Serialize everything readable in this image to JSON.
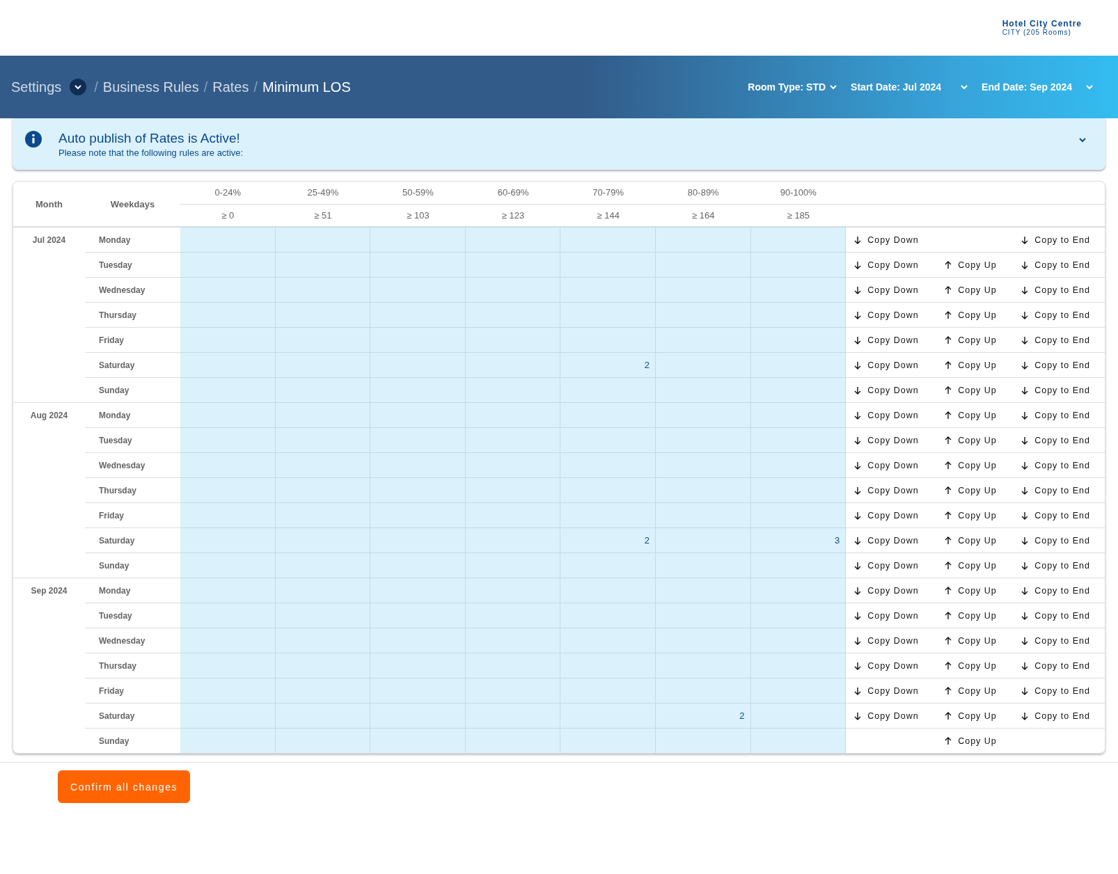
{
  "hotel": {
    "name": "Hotel City Centre",
    "subtitle": "CITY (205 Rooms)"
  },
  "breadcrumb": [
    {
      "label": "Settings",
      "dropdown": true,
      "current": false
    },
    {
      "separator": "/",
      "label": "Business Rules",
      "current": false
    },
    {
      "separator": "/",
      "label": "Rates",
      "current": false
    },
    {
      "separator": "/",
      "label": "Minimum LOS",
      "current": true
    }
  ],
  "filters": [
    {
      "label": "Room Type: STD"
    },
    {
      "label": "Start Date: Jul 2024"
    },
    {
      "label": "End Date: Sep 2024"
    }
  ],
  "alert": {
    "title": "Auto publish of Rates is Active!",
    "message": "Please note that the following rules are active:",
    "expanded": false
  },
  "table": {
    "columns": [
      "Month",
      "Weekdays"
    ],
    "bands": [
      {
        "occupancy": "0-24%",
        "threshold": "≥ 0"
      },
      {
        "occupancy": "25-49%",
        "threshold": "≥ 51"
      },
      {
        "occupancy": "50-59%",
        "threshold": "≥ 103"
      },
      {
        "occupancy": "60-69%",
        "threshold": "≥ 123"
      },
      {
        "occupancy": "70-79%",
        "threshold": "≥ 144"
      },
      {
        "occupancy": "80-89%",
        "threshold": "≥ 164"
      },
      {
        "occupancy": "90-100%",
        "threshold": "≥ 185"
      }
    ],
    "months": [
      {
        "month": "Jul 2024",
        "rows": [
          {
            "day": "Monday",
            "cells": [
              {},
              {},
              {},
              {},
              {},
              {},
              {}
            ],
            "actions": [
              {
                "kind": "down",
                "label": "Copy Down"
              },
              {
                "kind": "end",
                "label": "Copy to End"
              }
            ]
          },
          {
            "day": "Tuesday",
            "cells": [
              {},
              {},
              {},
              {},
              {},
              {},
              {}
            ],
            "actions": [
              {
                "kind": "down",
                "label": "Copy Down"
              },
              {
                "kind": "up",
                "label": "Copy Up"
              },
              {
                "kind": "end",
                "label": "Copy to End"
              }
            ]
          },
          {
            "day": "Wednesday",
            "cells": [
              {},
              {},
              {},
              {},
              {},
              {},
              {}
            ],
            "actions": [
              {
                "kind": "down",
                "label": "Copy Down"
              },
              {
                "kind": "up",
                "label": "Copy Up"
              },
              {
                "kind": "end",
                "label": "Copy to End"
              }
            ]
          },
          {
            "day": "Thursday",
            "cells": [
              {},
              {},
              {},
              {},
              {},
              {},
              {}
            ],
            "actions": [
              {
                "kind": "down",
                "label": "Copy Down"
              },
              {
                "kind": "up",
                "label": "Copy Up"
              },
              {
                "kind": "end",
                "label": "Copy to End"
              }
            ]
          },
          {
            "day": "Friday",
            "cells": [
              {},
              {},
              {},
              {},
              {},
              {},
              {}
            ],
            "actions": [
              {
                "kind": "down",
                "label": "Copy Down"
              },
              {
                "kind": "up",
                "label": "Copy Up"
              },
              {
                "kind": "end",
                "label": "Copy to End"
              }
            ]
          },
          {
            "day": "Saturday",
            "cells": [
              {},
              {},
              {},
              {},
              {
                "value": "2"
              },
              {},
              {}
            ],
            "actions": [
              {
                "kind": "down",
                "label": "Copy Down"
              },
              {
                "kind": "up",
                "label": "Copy Up"
              },
              {
                "kind": "end",
                "label": "Copy to End"
              }
            ]
          },
          {
            "day": "Sunday",
            "cells": [
              {},
              {},
              {},
              {},
              {},
              {},
              {}
            ],
            "actions": [
              {
                "kind": "down",
                "label": "Copy Down"
              },
              {
                "kind": "up",
                "label": "Copy Up"
              },
              {
                "kind": "end",
                "label": "Copy to End"
              }
            ]
          }
        ]
      },
      {
        "month": "Aug 2024",
        "rows": [
          {
            "day": "Monday",
            "cells": [
              {},
              {},
              {},
              {},
              {},
              {},
              {}
            ],
            "actions": [
              {
                "kind": "down",
                "label": "Copy Down"
              },
              {
                "kind": "up",
                "label": "Copy Up"
              },
              {
                "kind": "end",
                "label": "Copy to End"
              }
            ]
          },
          {
            "day": "Tuesday",
            "cells": [
              {},
              {},
              {},
              {},
              {},
              {},
              {}
            ],
            "actions": [
              {
                "kind": "down",
                "label": "Copy Down"
              },
              {
                "kind": "up",
                "label": "Copy Up"
              },
              {
                "kind": "end",
                "label": "Copy to End"
              }
            ]
          },
          {
            "day": "Wednesday",
            "cells": [
              {},
              {},
              {},
              {},
              {},
              {},
              {}
            ],
            "actions": [
              {
                "kind": "down",
                "label": "Copy Down"
              },
              {
                "kind": "up",
                "label": "Copy Up"
              },
              {
                "kind": "end",
                "label": "Copy to End"
              }
            ]
          },
          {
            "day": "Thursday",
            "cells": [
              {},
              {},
              {},
              {},
              {},
              {},
              {}
            ],
            "actions": [
              {
                "kind": "down",
                "label": "Copy Down"
              },
              {
                "kind": "up",
                "label": "Copy Up"
              },
              {
                "kind": "end",
                "label": "Copy to End"
              }
            ]
          },
          {
            "day": "Friday",
            "cells": [
              {},
              {},
              {},
              {},
              {},
              {},
              {}
            ],
            "actions": [
              {
                "kind": "down",
                "label": "Copy Down"
              },
              {
                "kind": "up",
                "label": "Copy Up"
              },
              {
                "kind": "end",
                "label": "Copy to End"
              }
            ]
          },
          {
            "day": "Saturday",
            "cells": [
              {},
              {},
              {},
              {},
              {
                "value": "2"
              },
              {},
              {
                "value": "3"
              }
            ],
            "actions": [
              {
                "kind": "down",
                "label": "Copy Down"
              },
              {
                "kind": "up",
                "label": "Copy Up"
              },
              {
                "kind": "end",
                "label": "Copy to End"
              }
            ]
          },
          {
            "day": "Sunday",
            "cells": [
              {},
              {},
              {},
              {},
              {},
              {},
              {}
            ],
            "actions": [
              {
                "kind": "down",
                "label": "Copy Down"
              },
              {
                "kind": "up",
                "label": "Copy Up"
              },
              {
                "kind": "end",
                "label": "Copy to End"
              }
            ]
          }
        ]
      },
      {
        "month": "Sep 2024",
        "rows": [
          {
            "day": "Monday",
            "cells": [
              {},
              {},
              {},
              {},
              {},
              {},
              {}
            ],
            "actions": [
              {
                "kind": "down",
                "label": "Copy Down"
              },
              {
                "kind": "up",
                "label": "Copy Up"
              },
              {
                "kind": "end",
                "label": "Copy to End"
              }
            ]
          },
          {
            "day": "Tuesday",
            "cells": [
              {},
              {},
              {},
              {},
              {},
              {},
              {}
            ],
            "actions": [
              {
                "kind": "down",
                "label": "Copy Down"
              },
              {
                "kind": "up",
                "label": "Copy Up"
              },
              {
                "kind": "end",
                "label": "Copy to End"
              }
            ]
          },
          {
            "day": "Wednesday",
            "cells": [
              {},
              {},
              {},
              {},
              {},
              {},
              {}
            ],
            "actions": [
              {
                "kind": "down",
                "label": "Copy Down"
              },
              {
                "kind": "up",
                "label": "Copy Up"
              },
              {
                "kind": "end",
                "label": "Copy to End"
              }
            ]
          },
          {
            "day": "Thursday",
            "cells": [
              {},
              {},
              {},
              {},
              {},
              {},
              {}
            ],
            "actions": [
              {
                "kind": "down",
                "label": "Copy Down"
              },
              {
                "kind": "up",
                "label": "Copy Up"
              },
              {
                "kind": "end",
                "label": "Copy to End"
              }
            ]
          },
          {
            "day": "Friday",
            "cells": [
              {},
              {},
              {},
              {},
              {},
              {},
              {}
            ],
            "actions": [
              {
                "kind": "down",
                "label": "Copy Down"
              },
              {
                "kind": "up",
                "label": "Copy Up"
              },
              {
                "kind": "end",
                "label": "Copy to End"
              }
            ]
          },
          {
            "day": "Saturday",
            "cells": [
              {},
              {},
              {},
              {},
              {},
              {
                "value": "2"
              },
              {}
            ],
            "actions": [
              {
                "kind": "down",
                "label": "Copy Down"
              },
              {
                "kind": "up",
                "label": "Copy Up"
              },
              {
                "kind": "end",
                "label": "Copy to End"
              }
            ]
          },
          {
            "day": "Sunday",
            "cells": [
              {},
              {},
              {},
              {},
              {},
              {},
              {}
            ],
            "actions": [
              {
                "kind": "up",
                "label": "Copy Up"
              }
            ]
          }
        ]
      }
    ]
  },
  "confirm_button": "Confirm all changes"
}
